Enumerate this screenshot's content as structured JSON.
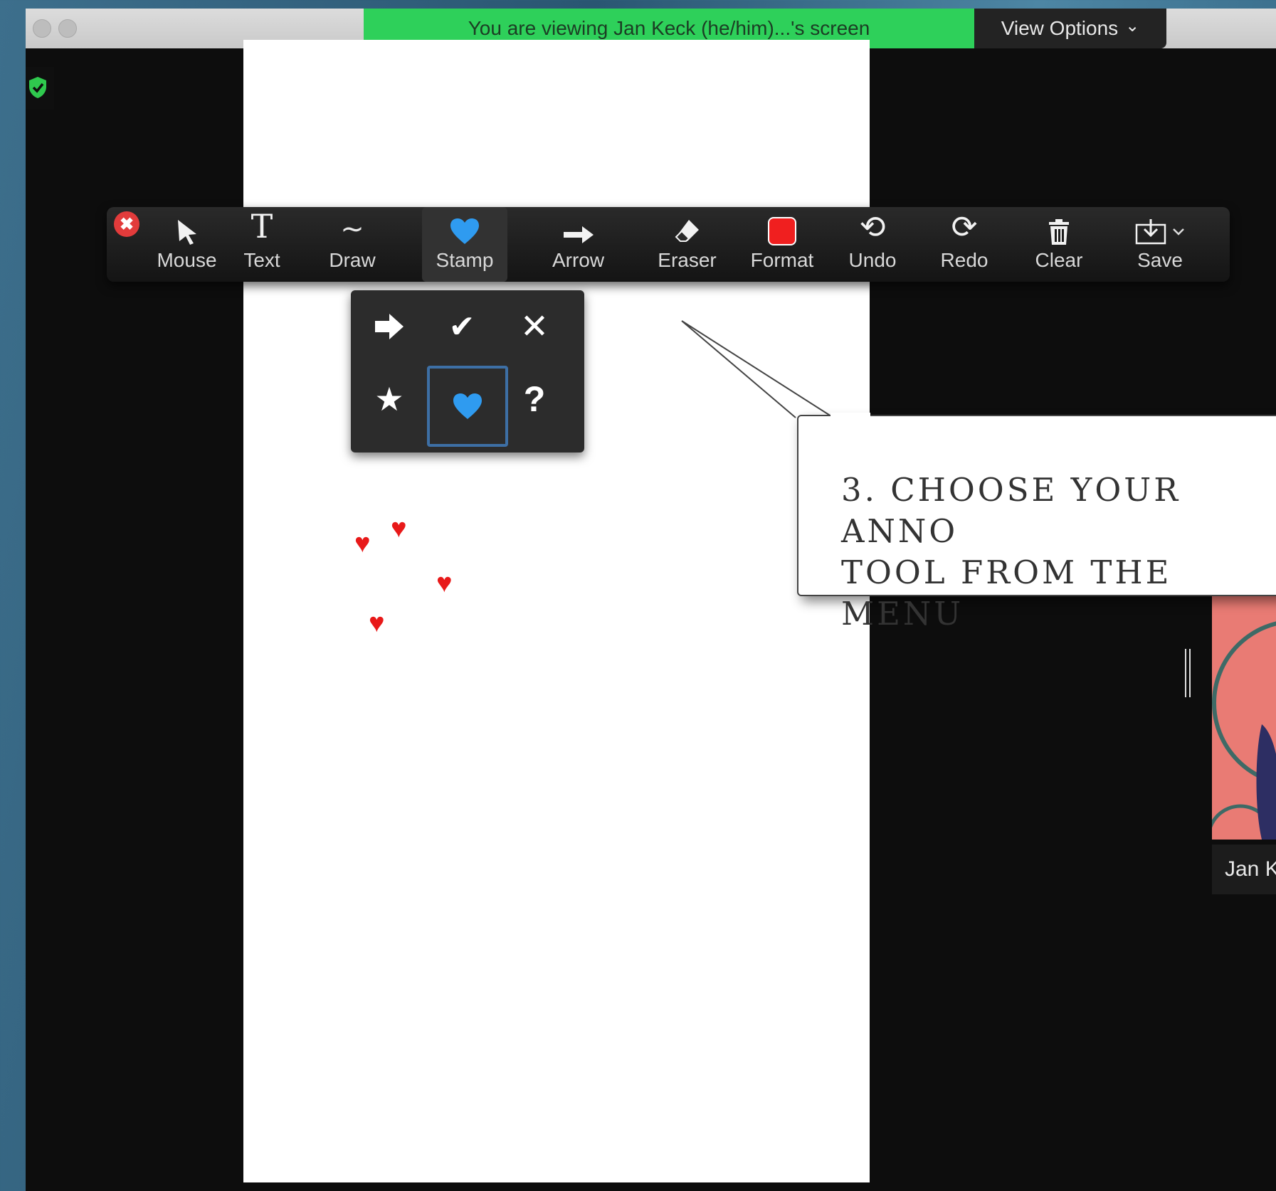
{
  "banner": {
    "text": "You are viewing Jan Keck (he/him)...'s screen"
  },
  "view_options": {
    "label": "View Options",
    "chevron": "⌄"
  },
  "toolbar": {
    "close_glyph": "✖",
    "tools": [
      {
        "id": "mouse",
        "label": "Mouse",
        "icon": "mouse-pointer-icon"
      },
      {
        "id": "text",
        "label": "Text",
        "icon": "text-icon",
        "glyph": "T"
      },
      {
        "id": "draw",
        "label": "Draw",
        "icon": "draw-icon",
        "glyph": "∼"
      },
      {
        "id": "stamp",
        "label": "Stamp",
        "icon": "heart-stamp-icon",
        "active": true
      },
      {
        "id": "arrow",
        "label": "Arrow",
        "icon": "arrow-icon"
      },
      {
        "id": "eraser",
        "label": "Eraser",
        "icon": "eraser-icon"
      },
      {
        "id": "format",
        "label": "Format",
        "icon": "format-color-icon",
        "color": "#f01f1f"
      },
      {
        "id": "undo",
        "label": "Undo",
        "icon": "undo-icon",
        "glyph": "⟲"
      },
      {
        "id": "redo",
        "label": "Redo",
        "icon": "redo-icon",
        "glyph": "⟳"
      },
      {
        "id": "clear",
        "label": "Clear",
        "icon": "trash-icon"
      },
      {
        "id": "save",
        "label": "Save",
        "icon": "save-icon"
      }
    ]
  },
  "stamp_menu": {
    "items": [
      {
        "name": "arrow-stamp",
        "icon": "arrow-right-icon"
      },
      {
        "name": "check-stamp",
        "icon": "check-icon",
        "glyph": "✔"
      },
      {
        "name": "x-stamp",
        "icon": "x-icon",
        "glyph": "✕"
      },
      {
        "name": "star-stamp",
        "icon": "star-icon",
        "glyph": "★"
      },
      {
        "name": "heart-stamp",
        "icon": "heart-icon",
        "selected": true
      },
      {
        "name": "question-stamp",
        "icon": "question-icon",
        "glyph": "?"
      }
    ]
  },
  "stamps_on_page": {
    "icon": "heart-icon",
    "color": "#e81919",
    "glyph": "♥"
  },
  "callout": {
    "text": "3. CHOOSE YOUR ANNO\nTOOL FROM THE MENU"
  },
  "participant": {
    "name": "Jan K"
  },
  "colors": {
    "banner": "#2ed05a",
    "heart_blue": "#2f9bf0",
    "heart_red": "#e81919",
    "callout_border": "#444444"
  }
}
